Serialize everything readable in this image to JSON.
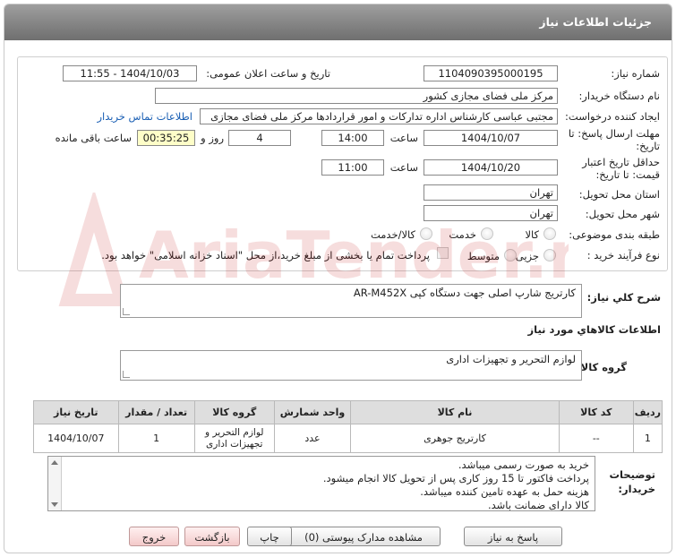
{
  "header": {
    "title": "جزئیات اطلاعات نیاز"
  },
  "form": {
    "need_number_label": "شماره نیاز:",
    "need_number": "1104090395000195",
    "announce_label": "تاریخ و ساعت اعلان عمومی:",
    "announce_value": "1404/10/03 - 11:55",
    "buyer_org_label": "نام دستگاه خریدار:",
    "buyer_org": "مرکز ملی فضای مجازی کشور",
    "requester_label": "ایجاد کننده درخواست:",
    "requester": "مجتبی عباسی کارشناس اداره تدارکات و امور قراردادها مرکز ملی فضای مجازی",
    "buyer_contact_link": "اطلاعات تماس خریدار",
    "deadline_label_line1": "مهلت ارسال پاسخ: تا",
    "deadline_label_line2": "تاریخ:",
    "deadline_date": "1404/10/07",
    "time_label": "ساعت",
    "deadline_time": "14:00",
    "days_value": "4",
    "days_label": "روز و",
    "remaining_time": "00:35:25",
    "remaining_label": "ساعت باقی مانده",
    "validity_label_line1": "حداقل تاریخ اعتبار",
    "validity_label_line2": "قیمت: تا تاریخ:",
    "validity_date": "1404/10/20",
    "validity_time_label": "ساعت",
    "validity_time": "11:00",
    "province_label": "استان محل تحویل:",
    "province": "تهران",
    "city_label": "شهر محل تحویل:",
    "city": "تهران",
    "category_label": "طبقه بندی موضوعی:",
    "category_options": [
      "کالا",
      "خدمت",
      "کالا/خدمت"
    ],
    "process_label": "نوع فرآیند خرید :",
    "process_options": [
      "جزیی",
      "متوسط"
    ],
    "payment_note": "پرداخت تمام یا بخشی از مبلغ خرید،از محل \"اسناد خزانه اسلامی\" خواهد بود."
  },
  "summary": {
    "label": "شرح كلي نياز:",
    "value": "کارتریج شارپ اصلی جهت دستگاه کپی AR-M452X"
  },
  "goods": {
    "section_title": "اطلاعات كالاهاي مورد نياز",
    "group_label": "گروه كالا:",
    "group_value": "لوازم التحریر و تجهیزات اداری",
    "table": {
      "headers": [
        "ردیف",
        "کد کالا",
        "نام کالا",
        "واحد شمارش",
        "گروه کالا",
        "تعداد / مقدار",
        "تاریخ نیاز"
      ],
      "rows": [
        [
          "1",
          "--",
          "کارتریج جوهری",
          "عدد",
          "لوازم التحریر و تجهیزات اداری",
          "1",
          "1404/10/07"
        ]
      ]
    }
  },
  "buyer_notes": {
    "label_line1": "توضیحات",
    "label_line2": "خریدار:",
    "lines": [
      "خرید به صورت رسمی میباشد.",
      "پرداخت فاکتور تا 15 روز کاری پس از تحویل کالا انجام میشود.",
      "هزینه حمل به عهده تامین کننده میباشد.",
      "کالا دارای ضمانت باشد."
    ]
  },
  "buttons": {
    "reply": "پاسخ به نیاز",
    "attachments": "مشاهده مدارک پیوستی (0)",
    "print": "چاپ",
    "back": "بازگشت",
    "exit": "خروج"
  },
  "watermark": {
    "text": "AriaTender.net"
  }
}
